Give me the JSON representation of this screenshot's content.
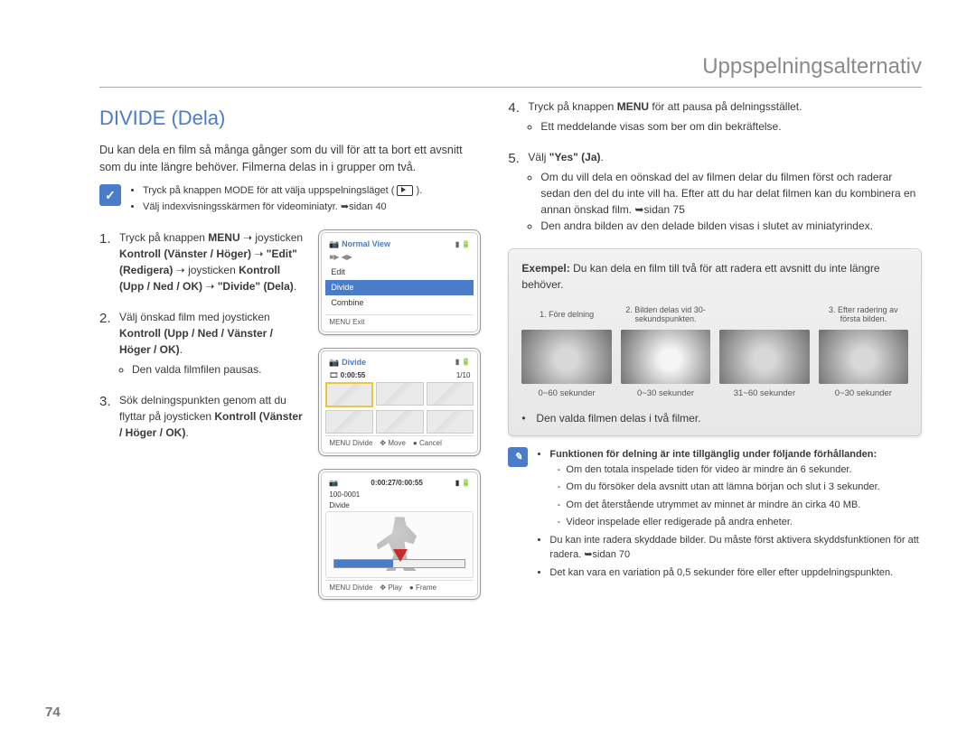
{
  "header": {
    "title": "Uppspelningsalternativ"
  },
  "page_number": "74",
  "heading": "DIVIDE (Dela)",
  "intro": "Du kan dela en film så många gånger som du vill för att ta bort ett avsnitt som du inte längre behöver. Filmerna delas in i grupper om två.",
  "precheck": {
    "items": [
      "Tryck på knappen MODE för att välja uppspelningsläget (",
      "Välj indexvisningsskärmen för videominiatyr. ➥sidan 40"
    ],
    "closing": ")."
  },
  "arrow": "➝",
  "steps_left": [
    {
      "num": "1.",
      "parts": [
        "Tryck på knappen ",
        "MENU",
        " ➝ joysticken ",
        "Kontroll (Vänster / Höger)",
        " ➝ ",
        "\"Edit\" (Redigera)",
        " ➝ joysticken ",
        "Kontroll (Upp / Ned / OK)",
        " ➝ ",
        "\"Divide\" (Dela)",
        "."
      ]
    },
    {
      "num": "2.",
      "parts": [
        "Välj önskad film med joysticken ",
        "Kontroll (Upp / Ned / Vänster / Höger / OK)",
        "."
      ],
      "sub": [
        "Den valda filmfilen pausas."
      ]
    },
    {
      "num": "3.",
      "parts": [
        "Sök delningspunkten genom att du flyttar på joysticken ",
        "Kontroll (Vänster / Höger / OK)",
        "."
      ]
    }
  ],
  "steps_right": [
    {
      "num": "4.",
      "parts": [
        "Tryck på knappen ",
        "MENU",
        " för att pausa på delningsstället."
      ],
      "sub": [
        "Ett meddelande visas som ber om din bekräftelse."
      ]
    },
    {
      "num": "5.",
      "parts": [
        "Välj ",
        "\"Yes\" (Ja)",
        "."
      ],
      "sub": [
        "Om du vill dela en oönskad del av filmen delar du filmen först och raderar sedan den del du inte vill ha. Efter att du har delat filmen kan du kombinera en annan önskad film. ➥sidan 75",
        "Den andra bilden av den delade bilden visas i slutet av miniatyrindex."
      ]
    }
  ],
  "lcd1": {
    "title": "Normal View",
    "list": [
      "Edit",
      "Divide",
      "Combine"
    ],
    "highlight_index": 1,
    "footer": [
      "MENU Exit"
    ]
  },
  "lcd2": {
    "title": "Divide",
    "time": "0:00:55",
    "counter": "1/10",
    "footer": [
      "MENU Divide",
      "Move",
      "Cancel"
    ]
  },
  "lcd3": {
    "file": "100-0001",
    "label": "Divide",
    "time": "0:00:27/0:00:55",
    "footer": [
      "MENU Divide",
      "Play",
      "Frame"
    ]
  },
  "example": {
    "lead_label": "Exempel:",
    "lead_text": " Du kan dela en film till två för att radera ett avsnitt du inte längre behöver.",
    "items": [
      {
        "caption": "1. Före delning",
        "below": "0~60 sekunder",
        "cls": "cactus"
      },
      {
        "caption": "2. Bilden delas vid 30-sekundspunkten.",
        "below": "0~30 sekunder",
        "cls": "flower"
      },
      {
        "caption": "",
        "below": "31~60 sekunder",
        "cls": "cactus"
      },
      {
        "caption": "3. Efter radering av första bilden.",
        "below": "0~30 sekunder",
        "cls": "cactus"
      }
    ],
    "result": "Den valda filmen delas i två filmer."
  },
  "note": {
    "lead": "Funktionen för delning är inte tillgänglig under följande förhållanden:",
    "sub": [
      "Om den totala inspelade tiden för video är mindre än 6 sekunder.",
      "Om du försöker dela avsnitt utan att lämna början och slut i 3 sekunder.",
      "Om det återstående utrymmet av minnet är mindre än cirka 40 MB.",
      "Videor inspelade eller redigerade på andra enheter."
    ],
    "extra": [
      "Du kan inte radera skyddade bilder. Du måste först aktivera skyddsfunktionen för att radera. ➥sidan 70",
      "Det kan vara en variation på 0,5 sekunder före eller efter uppdelningspunkten."
    ]
  }
}
